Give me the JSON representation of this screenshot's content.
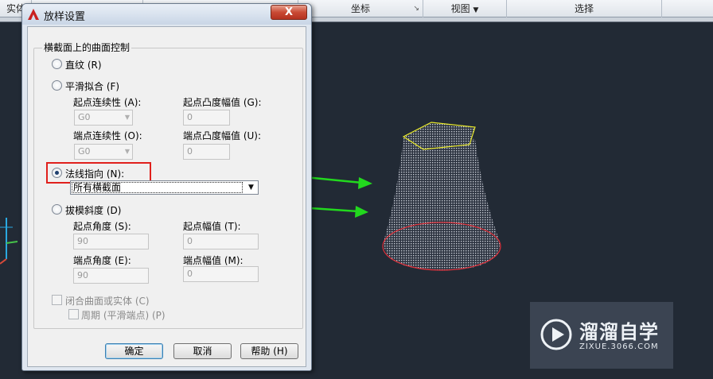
{
  "ribbon": {
    "cells": [
      "实体",
      "坐标",
      "视图",
      "选择"
    ]
  },
  "dialog": {
    "title": "放样设置",
    "close_label": "X",
    "group_title": "横截面上的曲面控制",
    "ruled": "直纹 (R)",
    "smooth_fit": "平滑拟合 (F)",
    "start_continuity_label": "起点连续性 (A):",
    "start_continuity_value": "G0",
    "start_bulge_label": "起点凸度幅值 (G):",
    "start_bulge_value": "0",
    "end_continuity_label": "端点连续性 (O):",
    "end_continuity_value": "G0",
    "end_bulge_label": "端点凸度幅值 (U):",
    "end_bulge_value": "0",
    "normal_to": "法线指向 (N):",
    "normal_to_selected": "所有横截面",
    "draft_angles": "拔模斜度 (D)",
    "start_angle_label": "起点角度 (S):",
    "start_angle_value": "90",
    "start_magnitude_label": "起点幅值 (T):",
    "start_magnitude_value": "0",
    "end_angle_label": "端点角度 (E):",
    "end_angle_value": "90",
    "end_magnitude_label": "端点幅值 (M):",
    "end_magnitude_value": "0",
    "close_surface": "闭合曲面或实体 (C)",
    "periodic": "周期 (平滑端点) (P)",
    "ok": "确定",
    "cancel": "取消",
    "help": "帮助 (H)"
  },
  "watermark": {
    "name": "溜溜自学",
    "url": "ZIXUE.3066.COM"
  },
  "colors": {
    "highlight_box": "#e0201c",
    "arrows": "#22d81e",
    "top_edge": "#e8e82a",
    "bottom_edge": "#e0303a"
  }
}
